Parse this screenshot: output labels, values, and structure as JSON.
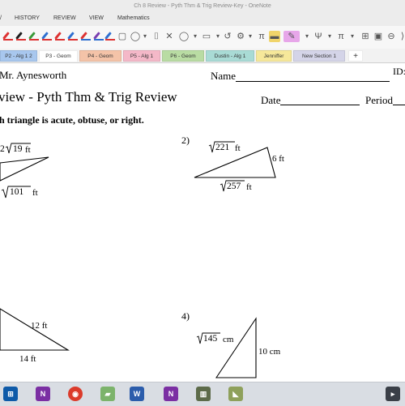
{
  "window": {
    "title": "Ch 8 Review - Pyth Thm & Trig Review-Key - OneNote"
  },
  "menu": {
    "history": "HISTORY",
    "review": "REVIEW",
    "view": "VIEW",
    "mathematics": "Mathematics"
  },
  "ribbon": {
    "pen_colors": [
      "#d33",
      "#1e1e1e",
      "#3a9a3a",
      "#2f6fd0",
      "#d33",
      "#2f6fd0",
      "#d33",
      "#7a3fb0",
      "#2f6fd0"
    ]
  },
  "tabs": [
    {
      "label": "P2 - Alg 1 2",
      "color": "#a8c7ee"
    },
    {
      "label": "P3 - Geom",
      "color": "#ffffff"
    },
    {
      "label": "P4 - Geom",
      "color": "#f4c3a8"
    },
    {
      "label": "P5 - Alg 1",
      "color": "#f4b8c8"
    },
    {
      "label": "P6 - Geom",
      "color": "#b9dca3"
    },
    {
      "label": "Dustin - Alg 1",
      "color": "#a9dbd5"
    },
    {
      "label": "Jenniffer",
      "color": "#f6e89a"
    },
    {
      "label": "New Section 1",
      "color": "#d4d4e8"
    },
    {
      "label": "+",
      "color": "#ffffff"
    }
  ],
  "page": {
    "teacher": "Mr. Aynesworth",
    "name_label": "Name",
    "id_label": "ID:",
    "title": "view - Pyth Thm & Trig Review",
    "date_label": "Date",
    "period_label": "Period",
    "instruction": "h triangle is acute, obtuse, or right.",
    "problems": {
      "p1": {
        "side_a_coef": "2",
        "side_a_root": "19",
        "side_a_unit": "ft",
        "side_b_root": "101",
        "side_b_unit": "ft"
      },
      "p2": {
        "number": "2)",
        "side_a_root": "221",
        "side_a_unit": "ft",
        "side_b": "6 ft",
        "side_c_root": "257",
        "side_c_unit": "ft"
      },
      "p3": {
        "side_a": "12 ft",
        "side_b": "14 ft"
      },
      "p4": {
        "number": "4)",
        "side_a_root": "145",
        "side_a_unit": "cm",
        "side_b": "10 cm"
      }
    }
  }
}
